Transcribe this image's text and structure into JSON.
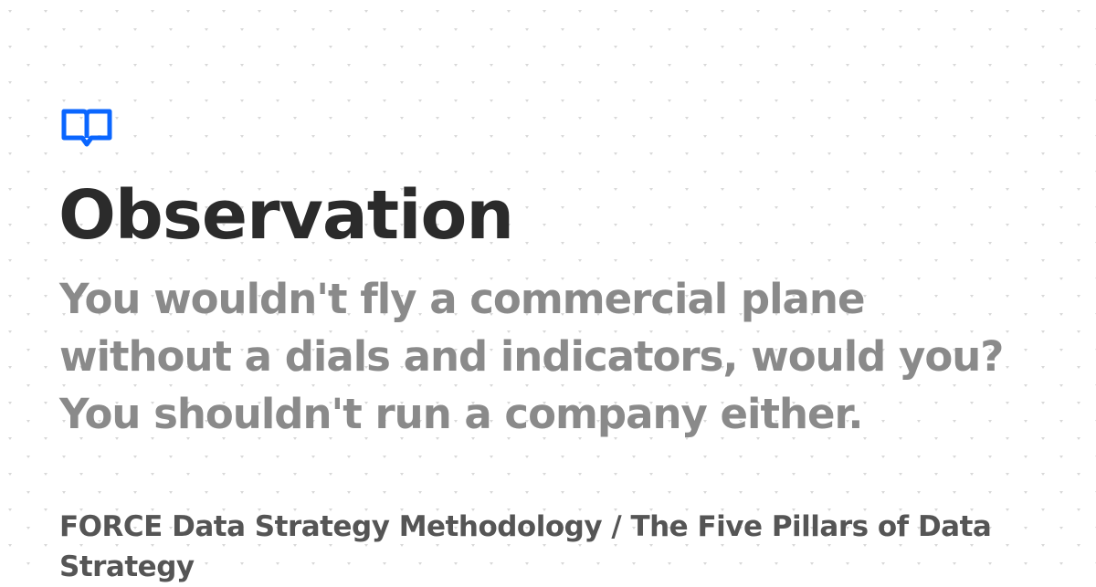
{
  "brand": {
    "icon": "open-book-icon",
    "accent_color": "#0a66ff"
  },
  "page": {
    "title": "Observation",
    "subtitle_lines": [
      "You wouldn't fly a commercial plane",
      "without a dials and indicators, would you?",
      "You shouldn't run a company either."
    ],
    "breadcrumb": "FORCE Data Strategy Methodology / The Five Pillars of Data Strategy"
  },
  "colors": {
    "background": "#ffffff",
    "title": "#2b2b2b",
    "subtitle": "#8a8a8a",
    "breadcrumb": "#555555",
    "pattern": "#d8d8d8"
  }
}
